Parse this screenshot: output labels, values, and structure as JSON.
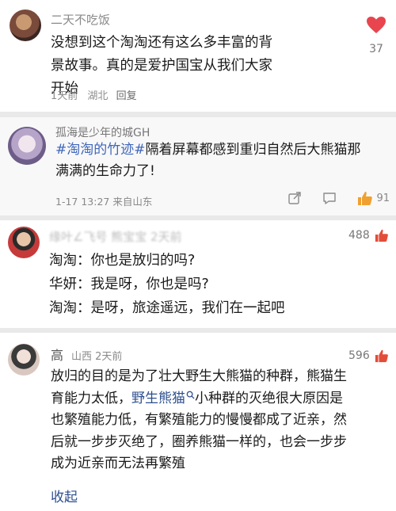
{
  "comments": [
    {
      "username": "二天不吃饭",
      "lines": [
        "没想到这个淘淘还有这么多丰富的背",
        "景故事。真的是爱护国宝从我们大家",
        "开始"
      ],
      "time": "1天前",
      "location": "湖北",
      "reply_label": "回复",
      "likes": "37"
    },
    {
      "username": "孤海是少年的城GH",
      "hashtag": "#淘淘的竹迹#",
      "text_line1": "隔着屏幕都感到重归自然后大熊猫那",
      "text_line2": "满满的生命力了!",
      "meta": "1-17 13:27  来自山东",
      "likes": "91"
    },
    {
      "username": "缘叶∠飞号  熊宝宝  2天前",
      "lines": [
        "淘淘：你也是放归的吗?",
        "华妍：我是呀，你也是吗?",
        "淘淘：是呀，旅途遥远，我们在一起吧"
      ],
      "likes": "488"
    },
    {
      "username": "高",
      "location_time": "山西 2天前",
      "line1": "放归的目的是为了壮大野生大熊猫的种群，熊猫生",
      "line2_pre": "育能力太低，",
      "line2_link": "野生熊猫",
      "line2_post": "小种群的灭绝很大原因是",
      "line3": "也繁殖能力低，有繁殖能力的慢慢都成了近亲，然",
      "line4": "后就一步步灭绝了，圈养熊猫一样的，也会一步步",
      "line5": "成为近亲而无法再繁殖",
      "collapse_label": "收起",
      "likes": "596"
    }
  ],
  "colors": {
    "heart": "#e8454e",
    "thumb": "#e24d3a",
    "link": "#2d4f8f",
    "hashtag": "#3f66ba"
  }
}
